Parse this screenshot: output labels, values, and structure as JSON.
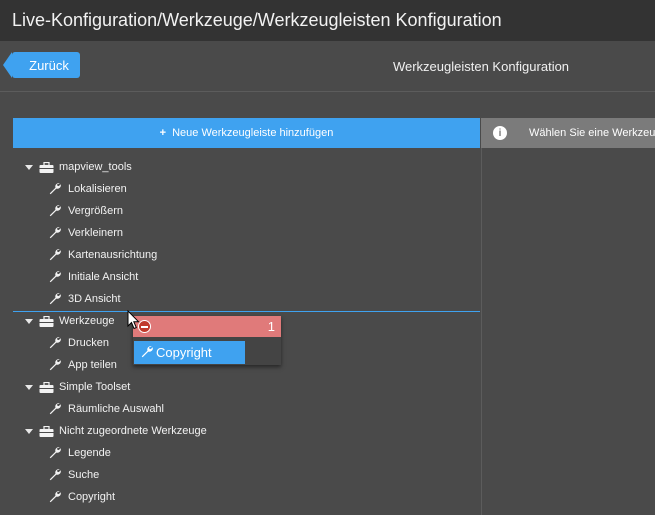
{
  "window": {
    "title": "Live-Konfiguration/Werkzeuge/Werkzeugleisten Konfiguration"
  },
  "header": {
    "back_label": "Zurück",
    "title": "Werkzeugleisten Konfiguration"
  },
  "toolbar": {
    "add_label": "Neue Werkzeugleiste hinzufügen",
    "add_icon": "plus-icon",
    "info_label": "Wählen Sie eine Werkzeugleiste",
    "info_icon": "info-icon"
  },
  "tree": {
    "groups": [
      {
        "label": "mapview_tools",
        "icon": "toolbox-icon",
        "items": [
          "Lokalisieren",
          "Vergrößern",
          "Verkleinern",
          "Kartenausrichtung",
          "Initiale Ansicht",
          "3D Ansicht"
        ]
      },
      {
        "label": "Werkzeuge",
        "icon": "toolbox-icon",
        "items": [
          "Drucken",
          "App teilen"
        ]
      },
      {
        "label": "Simple Toolset",
        "icon": "toolbox-icon",
        "items": [
          "Räumliche Auswahl"
        ]
      },
      {
        "label": "Nicht zugeordnete Werkzeuge",
        "icon": "toolbox-icon",
        "items": [
          "Legende",
          "Suche",
          "Copyright"
        ]
      }
    ]
  },
  "drag_preview": {
    "count": "1",
    "item_label": "Copyright",
    "item_icon": "wrench-icon",
    "remove_icon": "minus-circle-icon"
  },
  "colors": {
    "accent": "#3fa2f0",
    "background": "#4a4a4a",
    "titlebar": "#333333",
    "info_bar": "#7b7b7b",
    "drag_count": "#e07a7a"
  }
}
